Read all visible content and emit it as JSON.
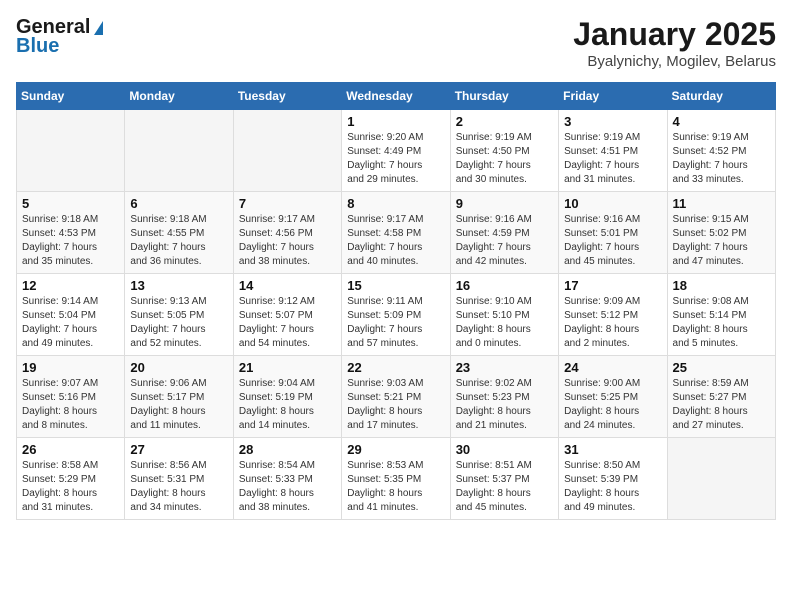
{
  "header": {
    "logo_general": "General",
    "logo_blue": "Blue",
    "month": "January 2025",
    "location": "Byalynichy, Mogilev, Belarus"
  },
  "weekdays": [
    "Sunday",
    "Monday",
    "Tuesday",
    "Wednesday",
    "Thursday",
    "Friday",
    "Saturday"
  ],
  "weeks": [
    [
      {
        "day": "",
        "info": ""
      },
      {
        "day": "",
        "info": ""
      },
      {
        "day": "",
        "info": ""
      },
      {
        "day": "1",
        "info": "Sunrise: 9:20 AM\nSunset: 4:49 PM\nDaylight: 7 hours\nand 29 minutes."
      },
      {
        "day": "2",
        "info": "Sunrise: 9:19 AM\nSunset: 4:50 PM\nDaylight: 7 hours\nand 30 minutes."
      },
      {
        "day": "3",
        "info": "Sunrise: 9:19 AM\nSunset: 4:51 PM\nDaylight: 7 hours\nand 31 minutes."
      },
      {
        "day": "4",
        "info": "Sunrise: 9:19 AM\nSunset: 4:52 PM\nDaylight: 7 hours\nand 33 minutes."
      }
    ],
    [
      {
        "day": "5",
        "info": "Sunrise: 9:18 AM\nSunset: 4:53 PM\nDaylight: 7 hours\nand 35 minutes."
      },
      {
        "day": "6",
        "info": "Sunrise: 9:18 AM\nSunset: 4:55 PM\nDaylight: 7 hours\nand 36 minutes."
      },
      {
        "day": "7",
        "info": "Sunrise: 9:17 AM\nSunset: 4:56 PM\nDaylight: 7 hours\nand 38 minutes."
      },
      {
        "day": "8",
        "info": "Sunrise: 9:17 AM\nSunset: 4:58 PM\nDaylight: 7 hours\nand 40 minutes."
      },
      {
        "day": "9",
        "info": "Sunrise: 9:16 AM\nSunset: 4:59 PM\nDaylight: 7 hours\nand 42 minutes."
      },
      {
        "day": "10",
        "info": "Sunrise: 9:16 AM\nSunset: 5:01 PM\nDaylight: 7 hours\nand 45 minutes."
      },
      {
        "day": "11",
        "info": "Sunrise: 9:15 AM\nSunset: 5:02 PM\nDaylight: 7 hours\nand 47 minutes."
      }
    ],
    [
      {
        "day": "12",
        "info": "Sunrise: 9:14 AM\nSunset: 5:04 PM\nDaylight: 7 hours\nand 49 minutes."
      },
      {
        "day": "13",
        "info": "Sunrise: 9:13 AM\nSunset: 5:05 PM\nDaylight: 7 hours\nand 52 minutes."
      },
      {
        "day": "14",
        "info": "Sunrise: 9:12 AM\nSunset: 5:07 PM\nDaylight: 7 hours\nand 54 minutes."
      },
      {
        "day": "15",
        "info": "Sunrise: 9:11 AM\nSunset: 5:09 PM\nDaylight: 7 hours\nand 57 minutes."
      },
      {
        "day": "16",
        "info": "Sunrise: 9:10 AM\nSunset: 5:10 PM\nDaylight: 8 hours\nand 0 minutes."
      },
      {
        "day": "17",
        "info": "Sunrise: 9:09 AM\nSunset: 5:12 PM\nDaylight: 8 hours\nand 2 minutes."
      },
      {
        "day": "18",
        "info": "Sunrise: 9:08 AM\nSunset: 5:14 PM\nDaylight: 8 hours\nand 5 minutes."
      }
    ],
    [
      {
        "day": "19",
        "info": "Sunrise: 9:07 AM\nSunset: 5:16 PM\nDaylight: 8 hours\nand 8 minutes."
      },
      {
        "day": "20",
        "info": "Sunrise: 9:06 AM\nSunset: 5:17 PM\nDaylight: 8 hours\nand 11 minutes."
      },
      {
        "day": "21",
        "info": "Sunrise: 9:04 AM\nSunset: 5:19 PM\nDaylight: 8 hours\nand 14 minutes."
      },
      {
        "day": "22",
        "info": "Sunrise: 9:03 AM\nSunset: 5:21 PM\nDaylight: 8 hours\nand 17 minutes."
      },
      {
        "day": "23",
        "info": "Sunrise: 9:02 AM\nSunset: 5:23 PM\nDaylight: 8 hours\nand 21 minutes."
      },
      {
        "day": "24",
        "info": "Sunrise: 9:00 AM\nSunset: 5:25 PM\nDaylight: 8 hours\nand 24 minutes."
      },
      {
        "day": "25",
        "info": "Sunrise: 8:59 AM\nSunset: 5:27 PM\nDaylight: 8 hours\nand 27 minutes."
      }
    ],
    [
      {
        "day": "26",
        "info": "Sunrise: 8:58 AM\nSunset: 5:29 PM\nDaylight: 8 hours\nand 31 minutes."
      },
      {
        "day": "27",
        "info": "Sunrise: 8:56 AM\nSunset: 5:31 PM\nDaylight: 8 hours\nand 34 minutes."
      },
      {
        "day": "28",
        "info": "Sunrise: 8:54 AM\nSunset: 5:33 PM\nDaylight: 8 hours\nand 38 minutes."
      },
      {
        "day": "29",
        "info": "Sunrise: 8:53 AM\nSunset: 5:35 PM\nDaylight: 8 hours\nand 41 minutes."
      },
      {
        "day": "30",
        "info": "Sunrise: 8:51 AM\nSunset: 5:37 PM\nDaylight: 8 hours\nand 45 minutes."
      },
      {
        "day": "31",
        "info": "Sunrise: 8:50 AM\nSunset: 5:39 PM\nDaylight: 8 hours\nand 49 minutes."
      },
      {
        "day": "",
        "info": ""
      }
    ]
  ]
}
